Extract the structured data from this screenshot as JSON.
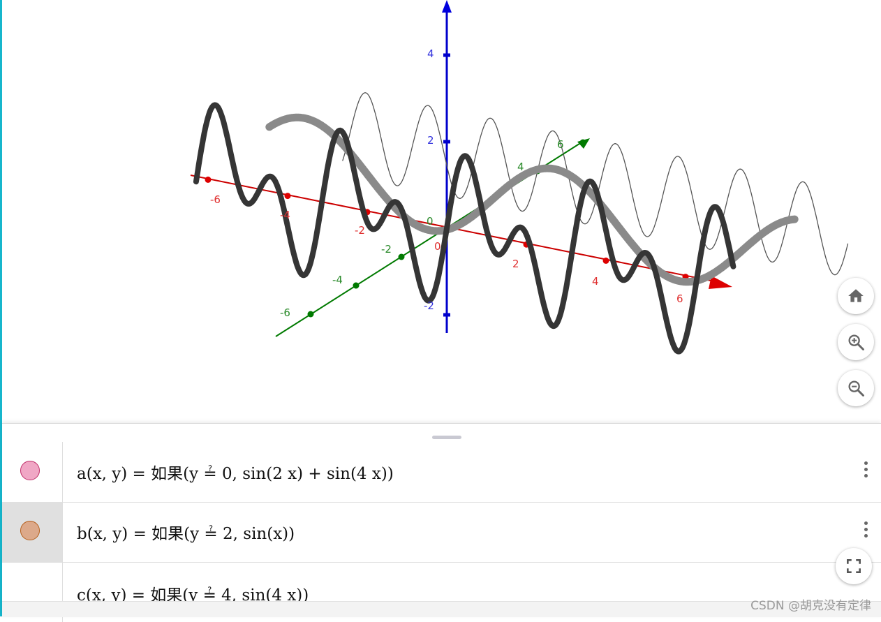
{
  "graphics": {
    "axes": {
      "x_ticks": [
        "-6",
        "-4",
        "-2",
        "0",
        "2",
        "4",
        "6"
      ],
      "y_ticks": [
        "-6",
        "-4",
        "-2",
        "0",
        "4",
        "6"
      ],
      "z_ticks": [
        "4",
        "2",
        "-2"
      ],
      "colors": {
        "x": "#cc0000",
        "y": "#007a00",
        "z": "#0000cc"
      }
    },
    "curves": [
      {
        "id": "a",
        "label": "a(x, y)",
        "color": "#333333",
        "function": "sin(2x) + sin(4x)",
        "plane_y": 0
      },
      {
        "id": "b",
        "label": "b(x, y)",
        "color": "#888888",
        "function": "sin(x)",
        "plane_y": 2
      },
      {
        "id": "c",
        "label": "c(x, y)",
        "color": "#555555",
        "function": "sin(4x)",
        "plane_y": 4
      }
    ],
    "buttons": {
      "home": "home-icon",
      "zoom_in": "zoom-in-icon",
      "zoom_out": "zoom-out-icon",
      "fullscreen": "fullscreen-icon"
    }
  },
  "algebra": {
    "rows": [
      {
        "name": "a",
        "formula": "a(x, y) = 如果(y ≟ 0, sin(2 x) + sin(4 x))",
        "marble_fill": "#f0a7c5",
        "marble_border": "#c0306a",
        "selected": false
      },
      {
        "name": "b",
        "formula": "b(x, y) = 如果(y ≟ 2, sin(x))",
        "marble_fill": "#dca98a",
        "marble_border": "#b5601e",
        "selected": true
      },
      {
        "name": "c",
        "formula": "c(x, y) = 如果(y ≟ 4, sin(4 x))",
        "marble_fill": "",
        "marble_border": "",
        "selected": false
      }
    ]
  },
  "watermark": "CSDN @胡克没有定律"
}
